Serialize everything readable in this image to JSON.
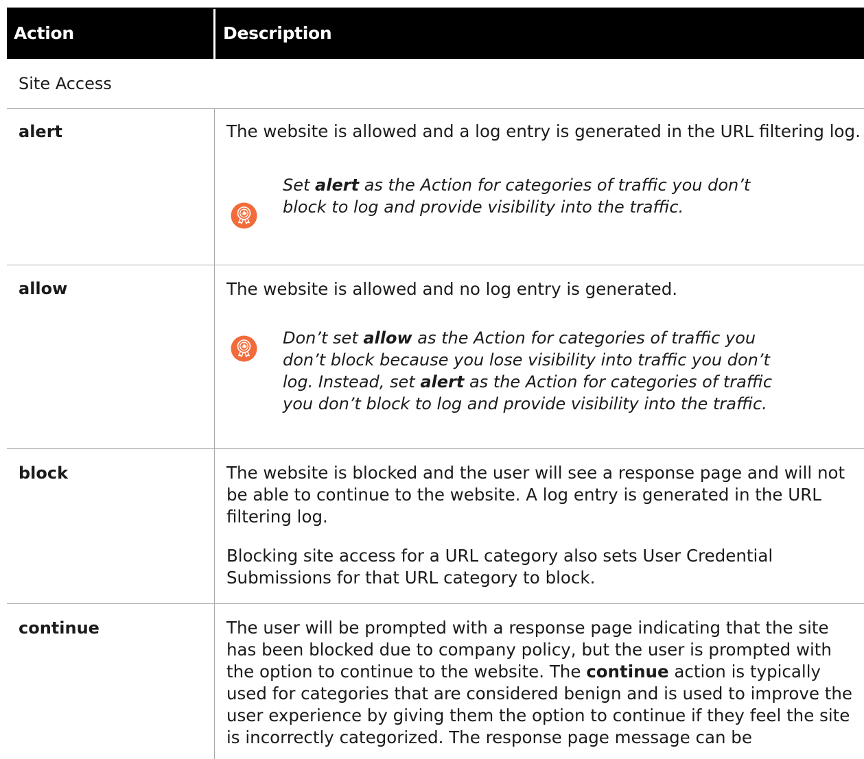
{
  "table": {
    "header": {
      "action": "Action",
      "description": "Description"
    },
    "section_title": "Site Access",
    "rows": [
      {
        "action": "alert",
        "description": "The website is allowed and a log entry is generated in the URL filtering log.",
        "tip": {
          "t1": "Set ",
          "b1": "alert",
          "t2": " as the Action for categories of traffic you don’t block to log and provide visibility into the traffic."
        }
      },
      {
        "action": "allow",
        "description": "The website is allowed and no log entry is generated.",
        "tip": {
          "t1": "Don’t set ",
          "b1": "allow",
          "t2": " as the Action for categories of traffic you don’t block because you lose visibility into traffic you don’t log. Instead, set ",
          "b2": "alert",
          "t3": " as the Action for categories of traffic you don’t block to log and provide visibility into the traffic."
        }
      },
      {
        "action": "block",
        "description": "The website is blocked and the user will see a response page and will not be able to continue to the website. A log entry is generated in the URL filtering log.",
        "description2": "Blocking site access for a URL category also sets User Credential Submissions for that URL category to block."
      },
      {
        "action": "continue",
        "d1": "The user will be prompted with a response page indicating that the site has been blocked due to company policy, but the user is prompted with the option to continue to the website. The ",
        "b1": "continue",
        "d2": " action is typically used for categories that are considered benign and is used to improve the user experience by giving them the option to continue if they feel the site is incorrectly categorized. The response page message can be"
      }
    ]
  },
  "icon": {
    "name": "best-practice-award-icon",
    "color": "#f26b3a"
  }
}
